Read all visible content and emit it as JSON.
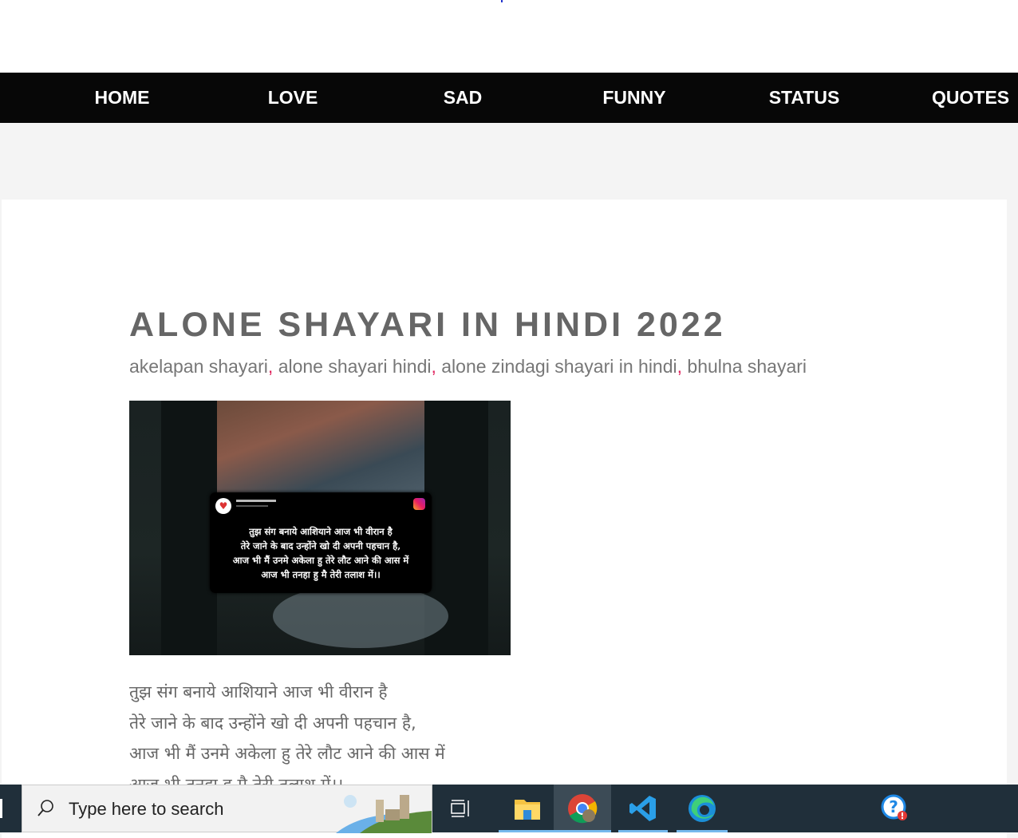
{
  "nav": {
    "items": [
      {
        "label": "HOME"
      },
      {
        "label": "LOVE"
      },
      {
        "label": "SAD"
      },
      {
        "label": "FUNNY"
      },
      {
        "label": "STATUS"
      },
      {
        "label": "QUOTES"
      }
    ]
  },
  "post": {
    "title": "ALONE SHAYARI IN HINDI 2022",
    "tags": [
      "akelapan shayari",
      "alone shayari hindi",
      "alone zindagi shayari in hindi",
      "bhulna shayari"
    ],
    "tag_separator": ",",
    "image_lines": [
      "तुझ संग बनाये आशियाने आज भी वीरान है",
      "तेरे जाने के बाद उन्होंने खो दी अपनी पहचान है,",
      "आज भी मैं उनमे अकेला हु तेरे लौट आने की आस में",
      "आज भी तनहा हु मै तेरी तलाश में।।"
    ],
    "poem_lines": [
      "तुझ संग बनाये आशियाने आज भी वीरान है",
      "तेरे जाने के बाद उन्होंने खो दी अपनी पहचान है,",
      "आज भी मैं उनमे अकेला हु तेरे लौट आने की आस में",
      "आज भी तनहा हु मै तेरी तलाश में।।"
    ]
  },
  "taskbar": {
    "search_placeholder": "Type here to search",
    "apps": [
      {
        "icon": "task-view-icon"
      },
      {
        "icon": "file-explorer-icon"
      },
      {
        "icon": "chrome-icon",
        "active": true
      },
      {
        "icon": "vscode-icon"
      },
      {
        "icon": "edge-icon"
      },
      {
        "icon": "help-icon"
      }
    ]
  },
  "colors": {
    "nav_bg": "#070707",
    "title": "#666666",
    "tag_separator": "#e0245e",
    "taskbar": "#202f3a"
  }
}
